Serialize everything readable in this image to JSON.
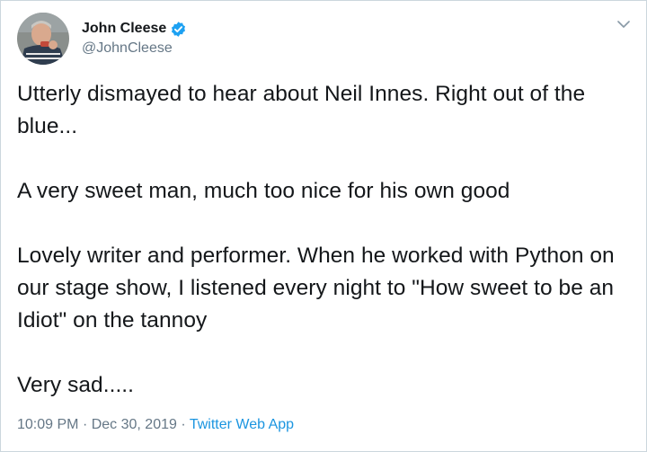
{
  "author": {
    "display_name": "John Cleese",
    "handle": "@JohnCleese",
    "verified": true,
    "avatar_icon": "profile-photo"
  },
  "menu_icon": "chevron-down-icon",
  "tweet": {
    "paragraphs": [
      "Utterly dismayed to hear about Neil Innes. Right out of the blue...",
      "A very sweet man, much too nice for his own good",
      "Lovely writer and performer. When he worked with Python on our stage show, I listened every night to \"How sweet to be an Idiot\" on the tannoy",
      "Very sad....."
    ]
  },
  "meta": {
    "time": "10:09 PM",
    "separator": "·",
    "date": "Dec 30, 2019",
    "source": "Twitter Web App"
  },
  "colors": {
    "text": "#14171a",
    "secondary": "#657786",
    "accent": "#1b95e0",
    "verified": "#1da1f2",
    "border": "#ccd6dd"
  }
}
